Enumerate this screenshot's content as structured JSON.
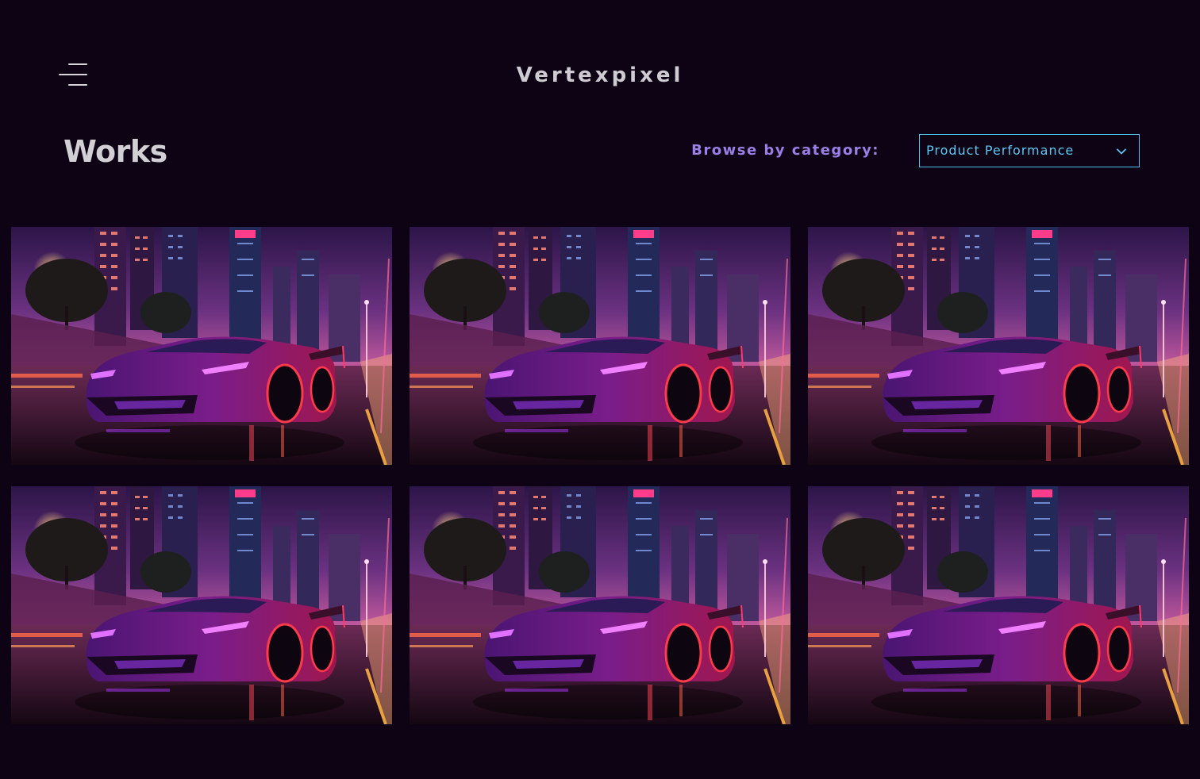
{
  "header": {
    "menu_icon": "hamburger-menu-icon",
    "brand": "Vertexpixel"
  },
  "main": {
    "title": "Works",
    "filter": {
      "label": "Browse by category:",
      "selected": "Product Performance",
      "icon": "chevron-down-icon"
    },
    "gallery": {
      "items": [
        {
          "image": "neon-car-city-night"
        },
        {
          "image": "neon-car-city-night"
        },
        {
          "image": "neon-car-city-night"
        },
        {
          "image": "neon-car-city-night"
        },
        {
          "image": "neon-car-city-night"
        },
        {
          "image": "neon-car-city-night"
        }
      ]
    }
  },
  "colors": {
    "background": "#0e0215",
    "accent_purple": "#9b7fe6",
    "accent_cyan": "#4dc3f2",
    "text_light": "#d2d0d4"
  }
}
